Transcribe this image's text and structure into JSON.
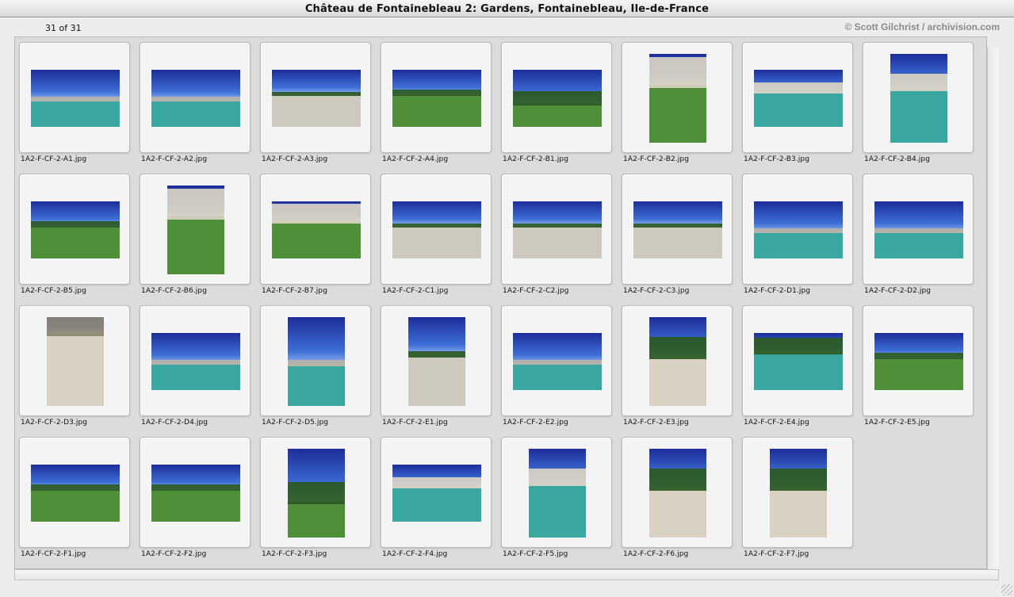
{
  "window": {
    "title": "Château de Fontainebleau 2: Gardens, Fontainebleau, Ile-de-France"
  },
  "info": {
    "count": "31 of 31",
    "credit": "© Scott Gilchrist / archivision.com"
  },
  "colors": {
    "sky_deep": "#1c2d9a",
    "sky": "#3f6fd6",
    "sky_light": "#9fc0f0",
    "water": "#3aa6a0",
    "grass": "#4f8f3a",
    "tree": "#2b5a22",
    "stone": "#d9d2c2",
    "gravel": "#cfcac0"
  },
  "thumbnails": [
    {
      "file": "1A2-F-CF-2-A1.jpg",
      "orient": "landscape",
      "scene": "water"
    },
    {
      "file": "1A2-F-CF-2-A2.jpg",
      "orient": "landscape",
      "scene": "water"
    },
    {
      "file": "1A2-F-CF-2-A3.jpg",
      "orient": "landscape",
      "scene": "gravel"
    },
    {
      "file": "1A2-F-CF-2-A4.jpg",
      "orient": "landscape",
      "scene": "lawn"
    },
    {
      "file": "1A2-F-CF-2-B1.jpg",
      "orient": "landscape",
      "scene": "trees"
    },
    {
      "file": "1A2-F-CF-2-B2.jpg",
      "orient": "portrait",
      "scene": "building"
    },
    {
      "file": "1A2-F-CF-2-B3.jpg",
      "orient": "landscape",
      "scene": "fountain"
    },
    {
      "file": "1A2-F-CF-2-B4.jpg",
      "orient": "portrait",
      "scene": "fountain"
    },
    {
      "file": "1A2-F-CF-2-B5.jpg",
      "orient": "landscape",
      "scene": "lawn"
    },
    {
      "file": "1A2-F-CF-2-B6.jpg",
      "orient": "portrait",
      "scene": "building"
    },
    {
      "file": "1A2-F-CF-2-B7.jpg",
      "orient": "landscape",
      "scene": "building"
    },
    {
      "file": "1A2-F-CF-2-C1.jpg",
      "orient": "landscape",
      "scene": "gravel"
    },
    {
      "file": "1A2-F-CF-2-C2.jpg",
      "orient": "landscape",
      "scene": "gravel"
    },
    {
      "file": "1A2-F-CF-2-C3.jpg",
      "orient": "landscape",
      "scene": "gravel"
    },
    {
      "file": "1A2-F-CF-2-D1.jpg",
      "orient": "landscape",
      "scene": "water"
    },
    {
      "file": "1A2-F-CF-2-D2.jpg",
      "orient": "landscape",
      "scene": "water"
    },
    {
      "file": "1A2-F-CF-2-D3.jpg",
      "orient": "portrait",
      "scene": "stone"
    },
    {
      "file": "1A2-F-CF-2-D4.jpg",
      "orient": "landscape",
      "scene": "water"
    },
    {
      "file": "1A2-F-CF-2-D5.jpg",
      "orient": "portrait",
      "scene": "water"
    },
    {
      "file": "1A2-F-CF-2-E1.jpg",
      "orient": "portrait",
      "scene": "gravel"
    },
    {
      "file": "1A2-F-CF-2-E2.jpg",
      "orient": "landscape",
      "scene": "water"
    },
    {
      "file": "1A2-F-CF-2-E3.jpg",
      "orient": "portrait",
      "scene": "statue"
    },
    {
      "file": "1A2-F-CF-2-E4.jpg",
      "orient": "landscape",
      "scene": "pond"
    },
    {
      "file": "1A2-F-CF-2-E5.jpg",
      "orient": "landscape",
      "scene": "lawn"
    },
    {
      "file": "1A2-F-CF-2-F1.jpg",
      "orient": "landscape",
      "scene": "lawn"
    },
    {
      "file": "1A2-F-CF-2-F2.jpg",
      "orient": "landscape",
      "scene": "lawn"
    },
    {
      "file": "1A2-F-CF-2-F3.jpg",
      "orient": "portrait",
      "scene": "trees"
    },
    {
      "file": "1A2-F-CF-2-F4.jpg",
      "orient": "landscape",
      "scene": "fountain"
    },
    {
      "file": "1A2-F-CF-2-F5.jpg",
      "orient": "portrait",
      "scene": "fountain"
    },
    {
      "file": "1A2-F-CF-2-F6.jpg",
      "orient": "portrait",
      "scene": "statue"
    },
    {
      "file": "1A2-F-CF-2-F7.jpg",
      "orient": "portrait",
      "scene": "statue"
    }
  ]
}
